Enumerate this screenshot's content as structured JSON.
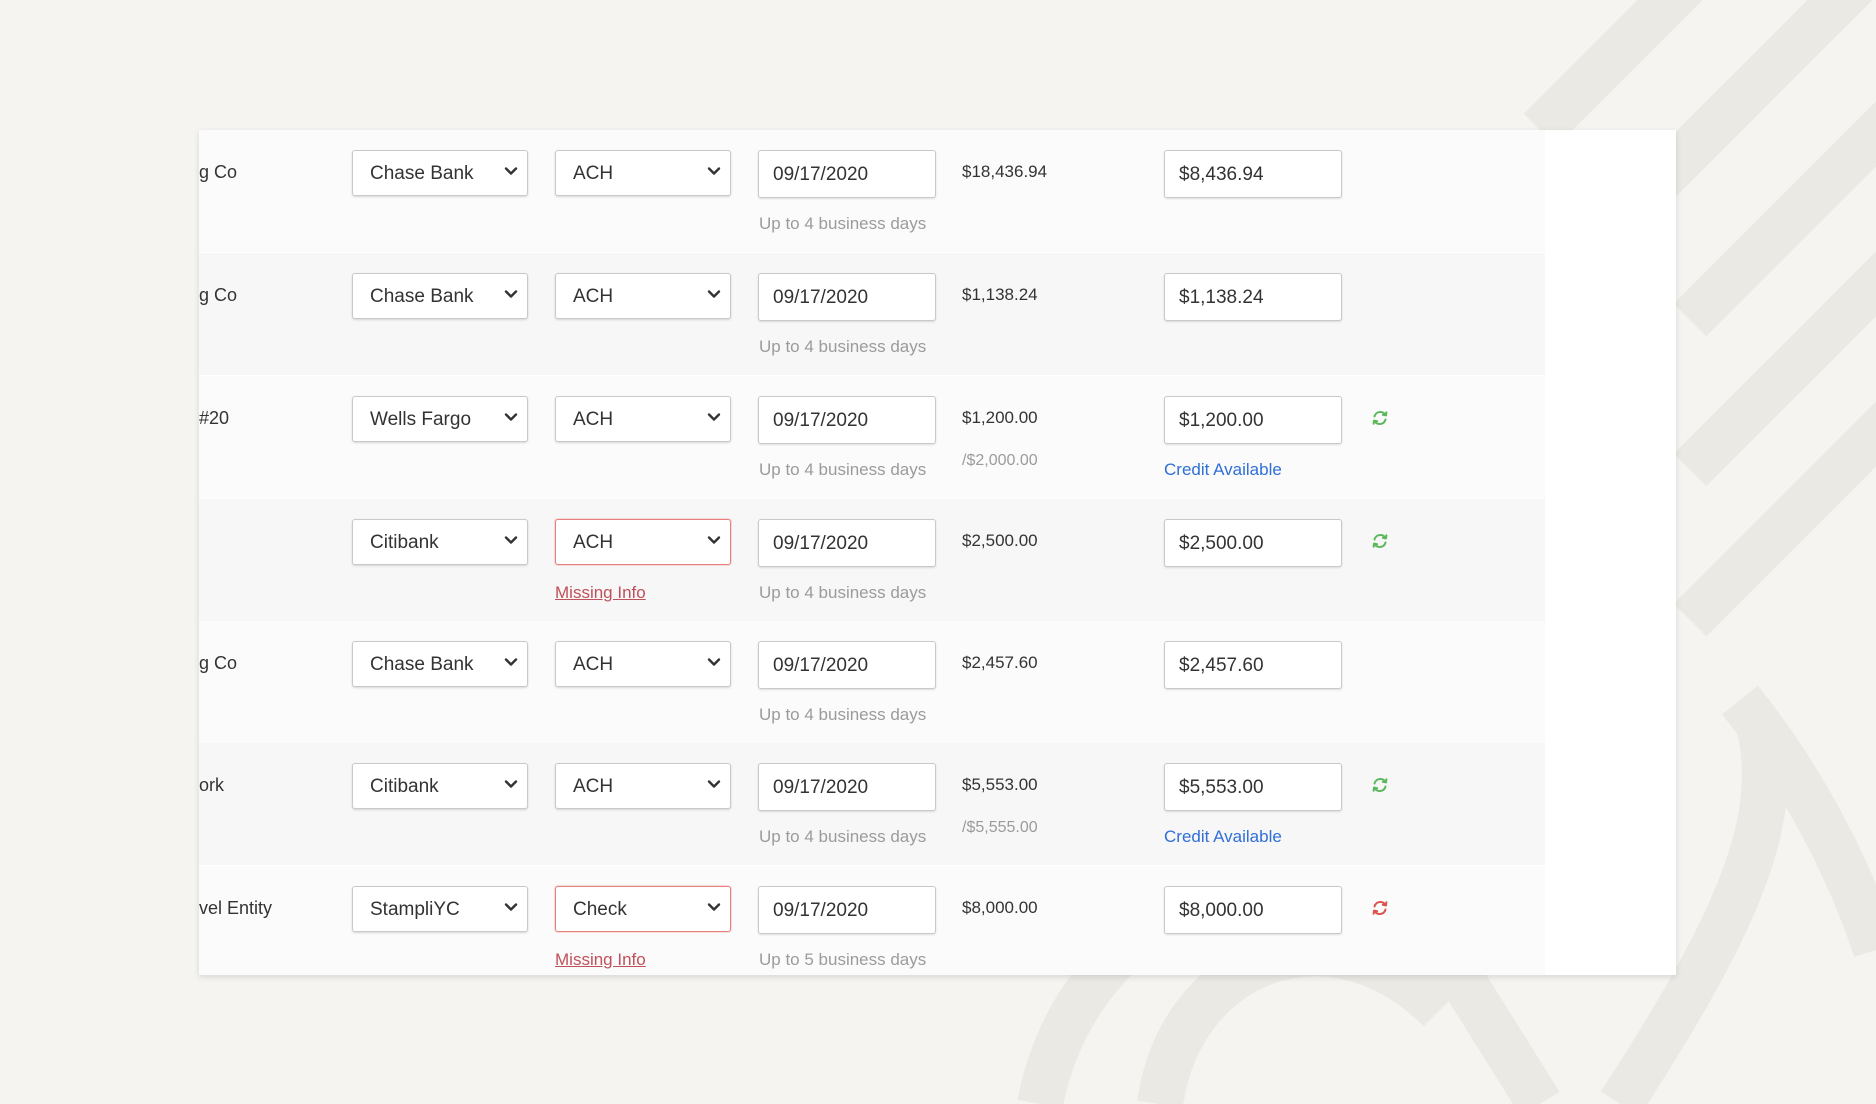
{
  "rows": [
    {
      "vendor": "g Co",
      "bank": "Chase Bank",
      "method": "ACH",
      "method_error": false,
      "date": "09/17/2020",
      "date_note": "Up to 4 business days",
      "missing_info": "",
      "amount": "$18,436.94",
      "amount_total": "",
      "pay_amount": "$8,436.94",
      "credit": "",
      "sync_icon": "",
      "sync_color": ""
    },
    {
      "vendor": "g Co",
      "bank": "Chase Bank",
      "method": "ACH",
      "method_error": false,
      "date": "09/17/2020",
      "date_note": "Up to 4 business days",
      "missing_info": "",
      "amount": "$1,138.24",
      "amount_total": "",
      "pay_amount": "$1,138.24",
      "credit": "",
      "sync_icon": "",
      "sync_color": ""
    },
    {
      "vendor": "#20",
      "bank": "Wells Fargo",
      "method": "ACH",
      "method_error": false,
      "date": "09/17/2020",
      "date_note": "Up to 4 business days",
      "missing_info": "",
      "amount": "$1,200.00",
      "amount_total": "/$2,000.00",
      "pay_amount": "$1,200.00",
      "credit": "Credit Available",
      "sync_icon": "sync-icon",
      "sync_color": "#5cb85c"
    },
    {
      "vendor": "",
      "bank": "Citibank",
      "method": "ACH",
      "method_error": true,
      "date": "09/17/2020",
      "date_note": "Up to 4 business days",
      "missing_info": "Missing Info",
      "amount": "$2,500.00",
      "amount_total": "",
      "pay_amount": "$2,500.00",
      "credit": "",
      "sync_icon": "sync-icon",
      "sync_color": "#5cb85c"
    },
    {
      "vendor": "g Co",
      "bank": "Chase Bank",
      "method": "ACH",
      "method_error": false,
      "date": "09/17/2020",
      "date_note": "Up to 4 business days",
      "missing_info": "",
      "amount": "$2,457.60",
      "amount_total": "",
      "pay_amount": "$2,457.60",
      "credit": "",
      "sync_icon": "",
      "sync_color": ""
    },
    {
      "vendor": "ork",
      "bank": "Citibank",
      "method": "ACH",
      "method_error": false,
      "date": "09/17/2020",
      "date_note": "Up to 4 business days",
      "missing_info": "",
      "amount": "$5,553.00",
      "amount_total": "/$5,555.00",
      "pay_amount": "$5,553.00",
      "credit": "Credit Available",
      "sync_icon": "sync-icon",
      "sync_color": "#5cb85c"
    },
    {
      "vendor": "vel Entity",
      "bank": "StampliYC",
      "method": "Check",
      "method_error": true,
      "date": "09/17/2020",
      "date_note": "Up to 5 business days",
      "missing_info": "Missing Info",
      "amount": "$8,000.00",
      "amount_total": "",
      "pay_amount": "$8,000.00",
      "credit": "",
      "sync_icon": "sync-icon",
      "sync_color": "#d9534f"
    }
  ]
}
